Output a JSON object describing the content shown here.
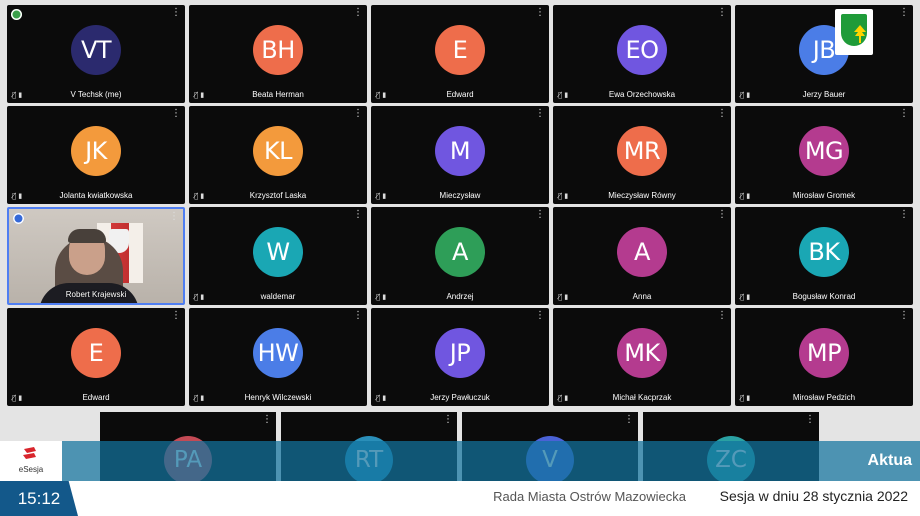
{
  "rows": [
    [
      {
        "initials": "VT",
        "name": "V Techsk (me)",
        "color": "#2b2a6e",
        "pin": "green"
      },
      {
        "initials": "BH",
        "name": "Beata Herman",
        "color": "#ee6d4b"
      },
      {
        "initials": "E",
        "name": "Edward",
        "color": "#ee6d4b"
      },
      {
        "initials": "EO",
        "name": "Ewa Orzechowska",
        "color": "#7056e0"
      },
      {
        "initials": "JB",
        "name": "Jerzy Bauer",
        "color": "#4b7de7"
      }
    ],
    [
      {
        "initials": "JK",
        "name": "Jolanta kwiatkowska",
        "color": "#f39a3c"
      },
      {
        "initials": "KL",
        "name": "Krzysztof Laska",
        "color": "#f39a3c"
      },
      {
        "initials": "M",
        "name": "Mieczysław",
        "color": "#7056e0"
      },
      {
        "initials": "MR",
        "name": "Mieczysław Równy",
        "color": "#ee6d4b"
      },
      {
        "initials": "MG",
        "name": "Mirosław Gromek",
        "color": "#b43b8f"
      }
    ],
    [
      {
        "video": true,
        "name": "Robert Krajewski",
        "pin": "blue"
      },
      {
        "initials": "W",
        "name": "waldemar",
        "color": "#1aa7b4"
      },
      {
        "initials": "A",
        "name": "Andrzej",
        "color": "#2e9e58"
      },
      {
        "initials": "A",
        "name": "Anna",
        "color": "#b43b8f"
      },
      {
        "initials": "BK",
        "name": "Bogusław Konrad",
        "color": "#1aa7b4"
      }
    ],
    [
      {
        "initials": "E",
        "name": "Edward",
        "color": "#ee6d4b"
      },
      {
        "initials": "HW",
        "name": "Henryk Wilczewski",
        "color": "#4b7de7"
      },
      {
        "initials": "JP",
        "name": "Jerzy Pawłuczuk",
        "color": "#7056e0"
      },
      {
        "initials": "MK",
        "name": "Michał Kacprzak",
        "color": "#b43b8f"
      },
      {
        "initials": "MP",
        "name": "Mirosław Pedzich",
        "color": "#b43b8f"
      }
    ]
  ],
  "lower_row": [
    {
      "initials": "PA",
      "color": "#c44a55"
    },
    {
      "initials": "RT",
      "color": "#2a8fb9"
    },
    {
      "initials": "V",
      "color": "#4a62d6"
    },
    {
      "initials": "ZC",
      "color": "#2aa1a3"
    }
  ],
  "more_glyph": "⋮",
  "mic_glyph": "🎙̸ ▮",
  "banner": {
    "brand": "eSesja",
    "ticker": "Aktua",
    "time": "15:12",
    "council": "Rada Miasta Ostrów Mazowiecka",
    "session": "Sesja w dniu 28 stycznia 2022"
  },
  "colors": {
    "tile_bg": "#0b0b0b",
    "band": "#12739e",
    "clock_bg": "#13588a",
    "active_border": "#4f7ef2"
  }
}
